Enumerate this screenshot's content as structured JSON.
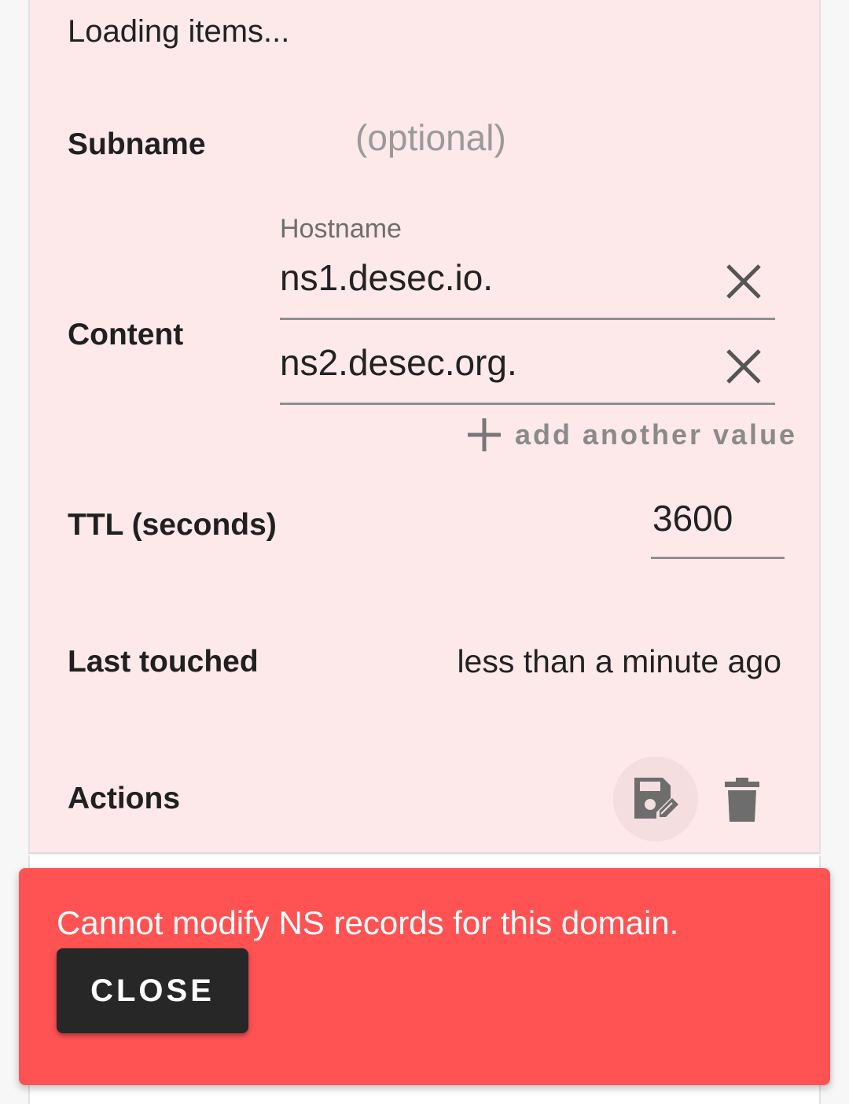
{
  "loading_text": "Loading items...",
  "subname": {
    "label": "Subname",
    "placeholder": "(optional)"
  },
  "content": {
    "label": "Content",
    "field_label": "Hostname",
    "values": [
      "ns1.desec.io.",
      "ns2.desec.org."
    ],
    "add_label": "add another value"
  },
  "ttl": {
    "label": "TTL (seconds)",
    "value": "3600"
  },
  "last_touched": {
    "label": "Last touched",
    "value": "less than a minute ago"
  },
  "actions": {
    "label": "Actions",
    "icons": [
      "save-edit-icon",
      "delete-icon"
    ]
  },
  "snackbar": {
    "message": "Cannot modify NS records for this domain.",
    "close_label": "CLOSE",
    "color": "#fe5253"
  }
}
